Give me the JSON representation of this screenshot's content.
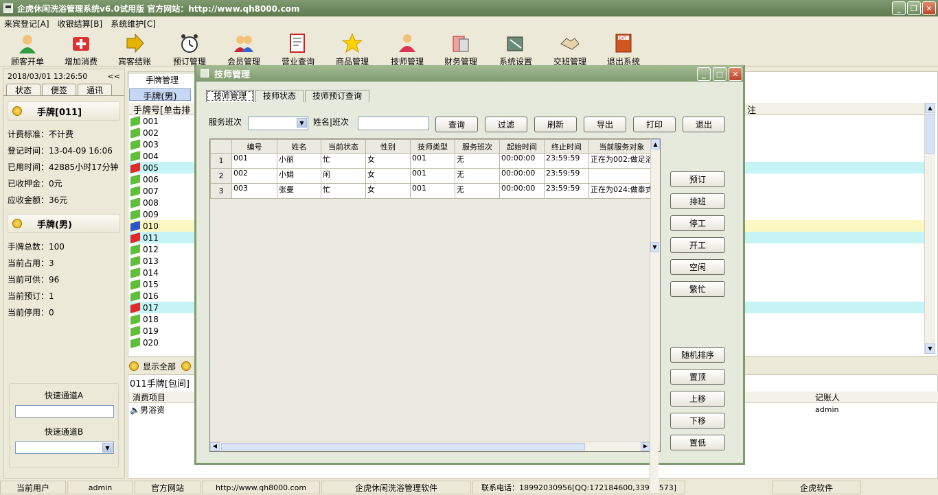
{
  "app": {
    "title": "企虎休闲洗浴管理系统v6.0试用版   官方网站：http://www.qh8000.com"
  },
  "menu": [
    "来宾登记[A]",
    "收银结算[B]",
    "系统维护[C]"
  ],
  "toolbar": [
    "顾客开单",
    "增加消费",
    "宾客结账",
    "预订管理",
    "会员管理",
    "营业查询",
    "商品管理",
    "技师管理",
    "财务管理",
    "系统设置",
    "交班管理",
    "退出系统"
  ],
  "left": {
    "datetime": "2018/03/01 13:26:50",
    "collapse": "<<",
    "tabs": [
      "状态",
      "便签",
      "通讯"
    ],
    "card1": "手牌[011]",
    "info1": [
      "计费标准：不计费",
      "登记时间：13-04-09 16:06",
      "已用时间：42885小时17分钟",
      "已收押金：0元",
      "应收金额：36元"
    ],
    "card2": "手牌(男)",
    "info2": [
      "手牌总数：100",
      "当前占用：3",
      "当前可供：96",
      "当前预订：1",
      "当前停用：0"
    ],
    "quickA": "快速通道A",
    "quickB": "快速通道B"
  },
  "main": {
    "tab": "手牌管理",
    "subtab": "手牌(男)",
    "colhead": "手牌号[单击排",
    "remark": "注",
    "rows": [
      {
        "id": "001",
        "c": "g"
      },
      {
        "id": "002",
        "c": "g"
      },
      {
        "id": "003",
        "c": "g"
      },
      {
        "id": "004",
        "c": "g"
      },
      {
        "id": "005",
        "c": "r",
        "bg": "#c6f4f6"
      },
      {
        "id": "006",
        "c": "g"
      },
      {
        "id": "007",
        "c": "g"
      },
      {
        "id": "008",
        "c": "g"
      },
      {
        "id": "009",
        "c": "g"
      },
      {
        "id": "010",
        "c": "b",
        "bg": "#fbf7c2"
      },
      {
        "id": "011",
        "c": "r",
        "bg": "#c6f4f6"
      },
      {
        "id": "012",
        "c": "g"
      },
      {
        "id": "013",
        "c": "g"
      },
      {
        "id": "014",
        "c": "g"
      },
      {
        "id": "015",
        "c": "g"
      },
      {
        "id": "016",
        "c": "g"
      },
      {
        "id": "017",
        "c": "r",
        "bg": "#c6f4f6"
      },
      {
        "id": "018",
        "c": "g"
      },
      {
        "id": "019",
        "c": "g"
      },
      {
        "id": "020",
        "c": "g"
      }
    ],
    "show_all": "显示全部",
    "bottom_title": "011手牌[包间]",
    "bottom_head": "消费项目",
    "bottom_head2": "记账人",
    "bottom_item": "男浴资",
    "bottom_user": "admin"
  },
  "status": {
    "user_label": "当前用户",
    "user": "admin",
    "site_label": "官方网站",
    "site": "http://www.qh8000.com",
    "product": "企虎休闲洗浴管理软件",
    "phone": "联系电话：18992030956[QQ:172184600,33903573]",
    "brand": "企虎软件"
  },
  "dialog": {
    "title": "技师管理",
    "tabs": [
      "技师管理",
      "技师状态",
      "技师预订查询"
    ],
    "shift_label": "服务班次",
    "name_label": "姓名|班次",
    "buttons": [
      "查询",
      "过滤",
      "刷新",
      "导出",
      "打印",
      "退出"
    ],
    "columns": [
      "编号",
      "姓名",
      "当前状态",
      "性别",
      "技师类型",
      "服务班次",
      "起始时间",
      "终止时间",
      "当前服务对象"
    ],
    "rows": [
      {
        "n": "1",
        "cells": [
          "001",
          "小丽",
          "忙",
          "女",
          "001",
          "无",
          "00:00:00",
          "23:59:59",
          "正在为002:做足浴"
        ]
      },
      {
        "n": "2",
        "cells": [
          "002",
          "小娟",
          "闲",
          "女",
          "001",
          "无",
          "00:00:00",
          "23:59:59",
          ""
        ]
      },
      {
        "n": "3",
        "cells": [
          "003",
          "张曼",
          "忙",
          "女",
          "001",
          "无",
          "00:00:00",
          "23:59:59",
          "正在为024:做泰式"
        ]
      }
    ],
    "side_top": [
      "预订",
      "排班",
      "停工",
      "开工",
      "空闲",
      "繁忙"
    ],
    "side_bottom": [
      "随机排序",
      "置顶",
      "上移",
      "下移",
      "置低"
    ]
  }
}
